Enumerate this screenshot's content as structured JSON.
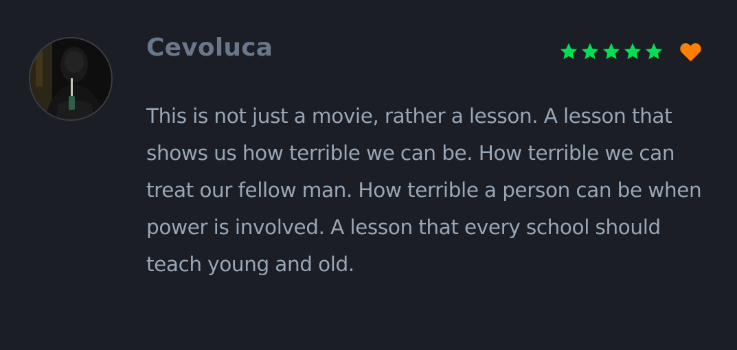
{
  "review": {
    "username": "Cevoluca",
    "avatar_icon": "user-avatar-photo",
    "rating": {
      "stars": 5,
      "max_stars": 5,
      "star_color": "#00e054",
      "liked": true,
      "heart_color": "#ff8000"
    },
    "body": "This is not just a movie, rather a lesson. A lesson that shows us how terrible we can be. How terrible we can treat our fellow man. How terrible a person can be when power is involved. A lesson that every school should teach young and old."
  },
  "colors": {
    "background": "#1b1e24",
    "username": "#687789",
    "body_text": "#98a7b7"
  }
}
